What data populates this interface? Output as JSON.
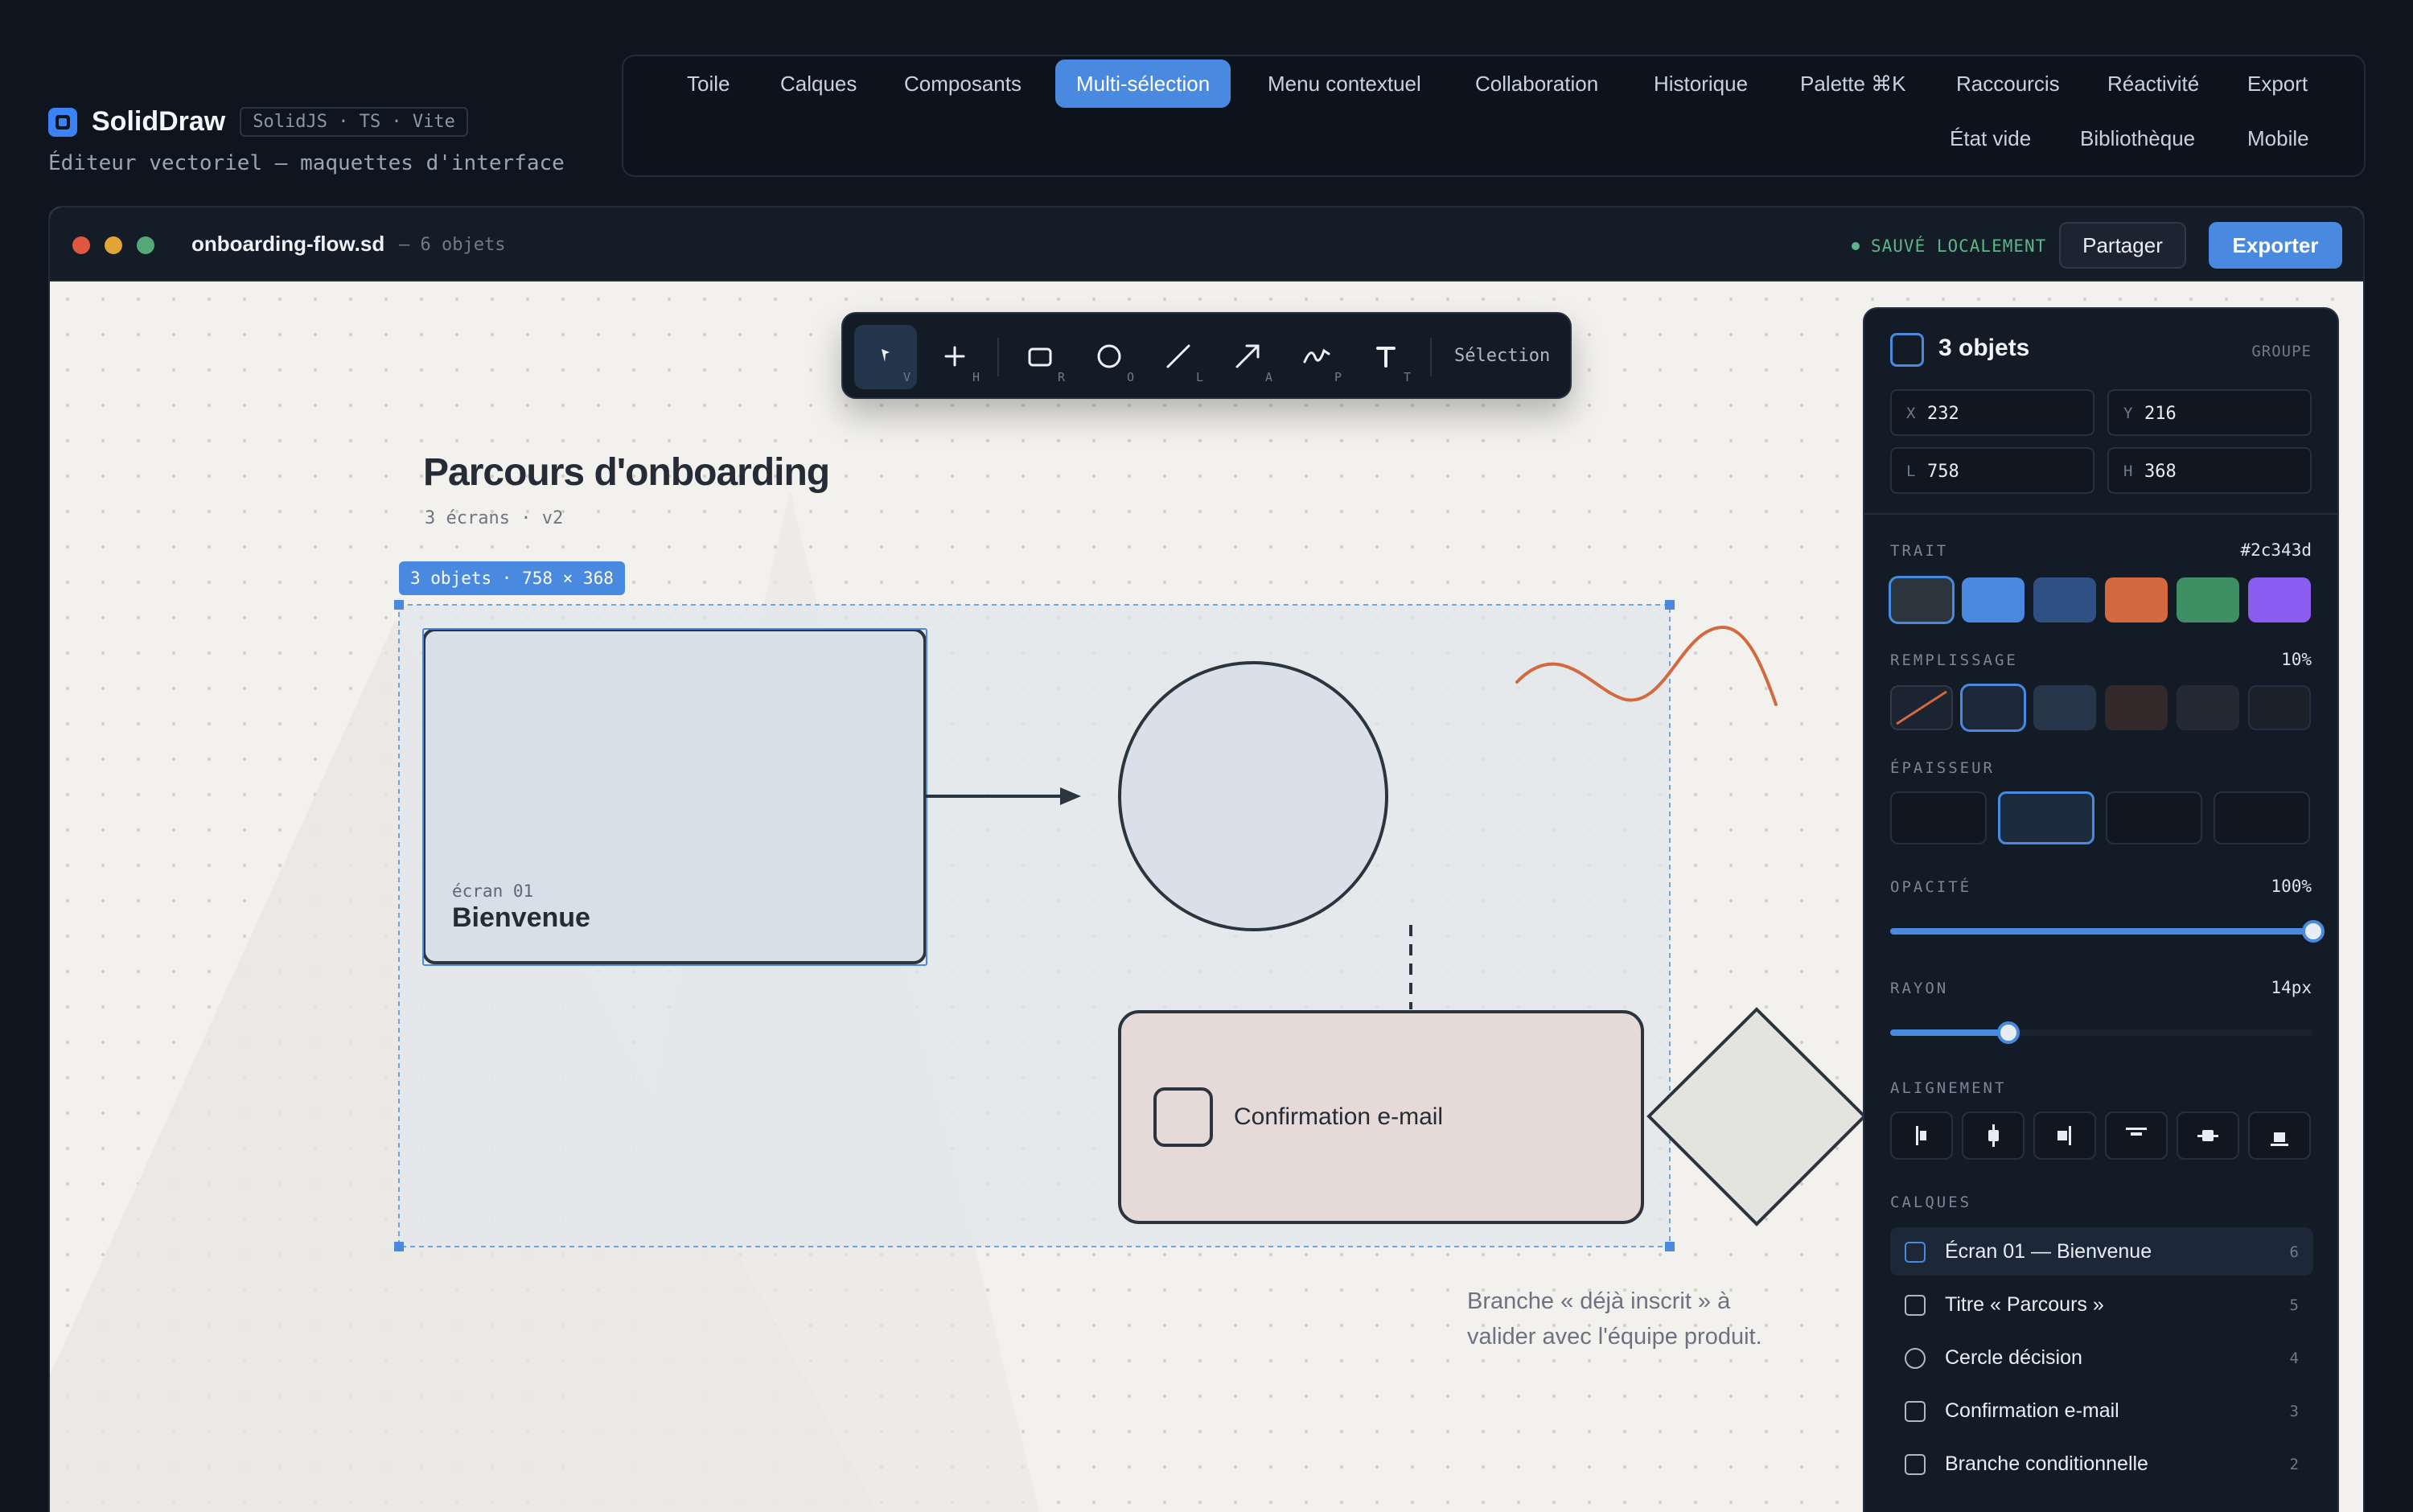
{
  "brand": {
    "name": "SolidDraw",
    "stack": "SolidJS · TS · Vite",
    "subtitle": "Éditeur vectoriel — maquettes d'interface"
  },
  "nav": {
    "items": [
      "Toile",
      "Calques",
      "Composants",
      "Multi-sélection",
      "Menu contextuel",
      "Collaboration",
      "Historique",
      "Palette ⌘K",
      "Raccourcis",
      "Réactivité",
      "Export",
      "État vide",
      "Bibliothèque",
      "Mobile"
    ],
    "active": "Multi-sélection"
  },
  "window": {
    "doc_name": "onboarding-flow.sd",
    "doc_count": "– 6 objets",
    "save_status": "SAUVÉ LOCALEMENT",
    "share_label": "Partager",
    "export_label": "Exporter",
    "traffic_colors": [
      "#e0573f",
      "#e3a437",
      "#55a979"
    ]
  },
  "toolbar": {
    "tools": [
      {
        "icon": "cursor-icon",
        "key": "V",
        "active": true
      },
      {
        "icon": "hand-plus-icon",
        "key": "H",
        "active": false
      },
      {
        "icon": "rectangle-icon",
        "key": "R",
        "active": false
      },
      {
        "icon": "ellipse-icon",
        "key": "O",
        "active": false
      },
      {
        "icon": "line-icon",
        "key": "L",
        "active": false
      },
      {
        "icon": "arrow-icon",
        "key": "A",
        "active": false
      },
      {
        "icon": "pen-icon",
        "key": "P",
        "active": false
      },
      {
        "icon": "text-icon",
        "key": "T",
        "active": false
      }
    ],
    "label": "Sélection"
  },
  "canvas": {
    "title": "Parcours d'onboarding",
    "subtitle": "3 écrans · v2",
    "selection_badge": "3 objets · 758 × 368",
    "screen_card": {
      "kicker": "écran 01",
      "title": "Bienvenue"
    },
    "email_card": {
      "title": "Confirmation e-mail"
    },
    "annotation": "Branche « déjà inscrit » à valider avec l'équipe produit.",
    "accent_orange": "#d2693f",
    "selection_color": "#4a89e0"
  },
  "panel": {
    "title": "3 objets",
    "tag": "GROUPE",
    "fields": {
      "x_label": "X",
      "x": "232",
      "y_label": "Y",
      "y": "216",
      "w_label": "L",
      "w": "758",
      "h_label": "H",
      "h": "368"
    },
    "stroke": {
      "label": "TRAIT",
      "value": "#2c343d",
      "colors": [
        "#2c343d",
        "#4a89e0",
        "#2f5082",
        "#d2693f",
        "#3f8f64",
        "#8a5cf0"
      ]
    },
    "fill": {
      "label": "REMPLISSAGE",
      "value": "10%"
    },
    "thickness": {
      "label": "ÉPAISSEUR"
    },
    "opacity": {
      "label": "OPACITÉ",
      "value": "100%",
      "level": 1.0
    },
    "radius": {
      "label": "RAYON",
      "value": "14px",
      "level": 0.28
    },
    "alignment": {
      "label": "ALIGNEMENT",
      "icons": [
        "align-left-icon",
        "align-center-h-icon",
        "align-right-icon",
        "align-top-icon",
        "align-middle-v-icon",
        "align-bottom-icon"
      ]
    },
    "layers": {
      "label": "CALQUES",
      "items": [
        {
          "name": "Écran 01 — Bienvenue",
          "num": "6"
        },
        {
          "name": "Titre « Parcours »",
          "num": "5"
        },
        {
          "name": "Cercle décision",
          "num": "4"
        },
        {
          "name": "Confirmation e-mail",
          "num": "3"
        },
        {
          "name": "Branche conditionnelle",
          "num": "2"
        }
      ]
    }
  }
}
